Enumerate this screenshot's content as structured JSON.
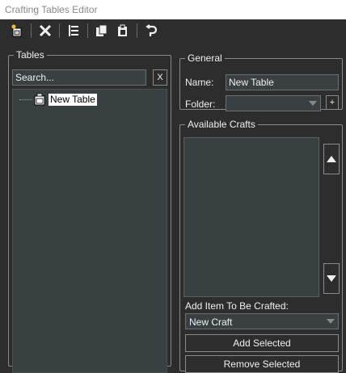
{
  "window": {
    "title": "Crafting Tables Editor"
  },
  "toolbar": {
    "buttons": [
      {
        "icon": "new-table-icon"
      },
      {
        "icon": "delete-icon"
      },
      {
        "icon": "tree-view-icon"
      },
      {
        "icon": "copy-icon"
      },
      {
        "icon": "paste-icon"
      },
      {
        "icon": "undo-icon"
      }
    ]
  },
  "tables": {
    "legend": "Tables",
    "search_placeholder": "Search...",
    "clear_label": "X",
    "tree": [
      {
        "label": "New Table"
      }
    ]
  },
  "general": {
    "legend": "General",
    "name_label": "Name:",
    "name_value": "New Table",
    "folder_label": "Folder:",
    "folder_value": "",
    "add_folder_label": "+"
  },
  "crafts": {
    "legend": "Available Crafts",
    "add_item_label": "Add Item To Be Crafted:",
    "selected_craft": "New Craft",
    "add_selected_label": "Add Selected",
    "remove_selected_label": "Remove Selected"
  },
  "colors": {
    "background": "#2d2d2d",
    "panel": "#394042",
    "border": "#8a8a8a",
    "text": "#f0f0f0"
  }
}
